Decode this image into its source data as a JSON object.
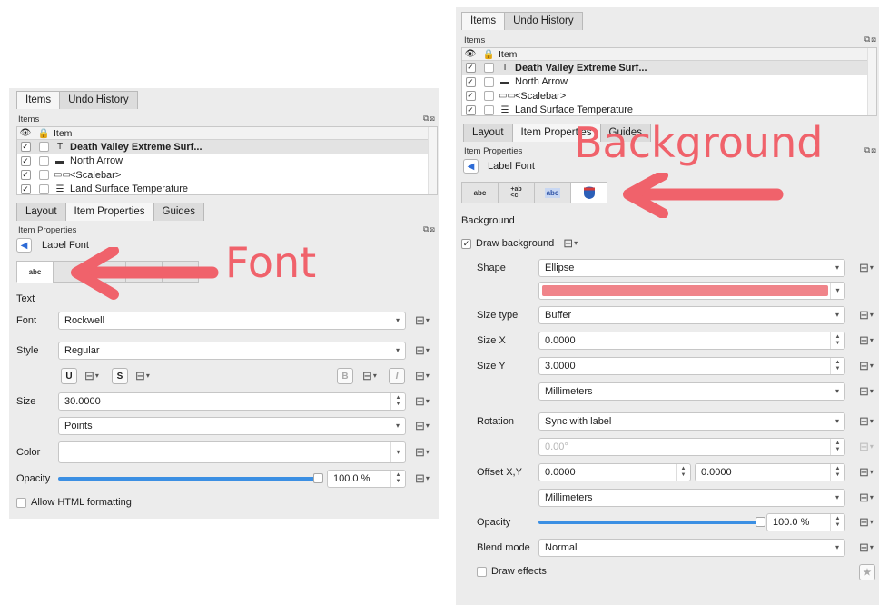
{
  "left_panel": {
    "tabs": [
      "Items",
      "Undo History"
    ],
    "items_label": "Items",
    "tree_header": "Item",
    "tree_rows": [
      {
        "name": "Death Valley Extreme Surf...",
        "icon": "T",
        "bold": true
      },
      {
        "name": "North Arrow",
        "icon": "▬",
        "bold": false
      },
      {
        "name": "<Scalebar>",
        "icon": "▭▭",
        "bold": false
      },
      {
        "name": "Land Surface Temperature",
        "icon": "☰",
        "bold": false
      }
    ],
    "bottom_tabs": [
      "Layout",
      "Item Properties",
      "Guides"
    ],
    "item_props_label": "Item Properties",
    "label_font": "Label Font",
    "section_text": "Text",
    "font_label": "Font",
    "font_value": "Rockwell",
    "style_label": "Style",
    "style_value": "Regular",
    "size_label": "Size",
    "size_value": "30.0000",
    "size_unit": "Points",
    "color_label": "Color",
    "opacity_label": "Opacity",
    "opacity_value": "100.0 %",
    "opacity_fraction": 1.0,
    "allow_html": "Allow HTML formatting",
    "fmt_buttons": [
      "U",
      "S",
      "B",
      "I"
    ]
  },
  "right_panel": {
    "tabs": [
      "Items",
      "Undo History"
    ],
    "items_label": "Items",
    "tree_header": "Item",
    "tree_rows": [
      {
        "name": "Death Valley Extreme Surf...",
        "icon": "T",
        "bold": true
      },
      {
        "name": "North Arrow",
        "icon": "▬",
        "bold": false
      },
      {
        "name": "<Scalebar>",
        "icon": "▭▭",
        "bold": false
      },
      {
        "name": "Land Surface Temperature",
        "icon": "☰",
        "bold": false
      }
    ],
    "bottom_tabs": [
      "Layout",
      "Item Properties",
      "Guides"
    ],
    "item_props_label": "Item Properties",
    "label_font": "Label Font",
    "section_background": "Background",
    "draw_background": "Draw background",
    "shape_label": "Shape",
    "shape_value": "Ellipse",
    "fill_color": "#f0848a",
    "size_type_label": "Size type",
    "size_type_value": "Buffer",
    "size_x_label": "Size X",
    "size_x_value": "0.0000",
    "size_y_label": "Size Y",
    "size_y_value": "3.0000",
    "size_unit": "Millimeters",
    "rotation_label": "Rotation",
    "rotation_value": "Sync with label",
    "rotation_angle": "0.00°",
    "offset_label": "Offset X,Y",
    "offset_x": "0.0000",
    "offset_y": "0.0000",
    "offset_unit": "Millimeters",
    "opacity_label": "Opacity",
    "opacity_value": "100.0 %",
    "opacity_fraction": 1.0,
    "blend_label": "Blend mode",
    "blend_value": "Normal",
    "draw_effects": "Draw effects"
  },
  "annotations": {
    "font": "Font",
    "background": "Background",
    "color": "#f0626b"
  }
}
